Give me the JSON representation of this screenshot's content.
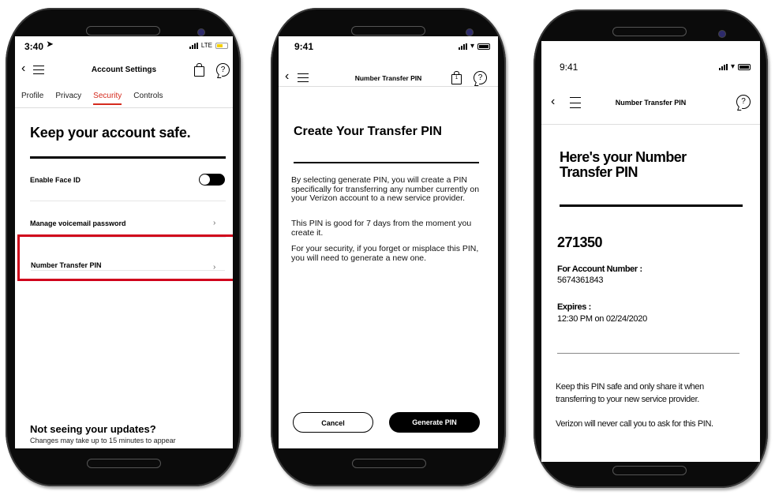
{
  "colors": {
    "accent": "#d52b1e",
    "highlight": "#d0021b",
    "toggle": "#000000"
  },
  "phone1": {
    "status": {
      "time": "3:40",
      "location_icon": "location-arrow-icon",
      "network": "LTE",
      "battery": "low-yellow"
    },
    "nav": {
      "title": "Account Settings",
      "icons": [
        "back-chevron-icon",
        "menu-icon",
        "bag-icon",
        "help-chat-icon"
      ]
    },
    "tabs": [
      {
        "label": "Profile",
        "active": false
      },
      {
        "label": "Privacy",
        "active": false
      },
      {
        "label": "Security",
        "active": true
      },
      {
        "label": "Controls",
        "active": false
      }
    ],
    "heading": "Keep your account safe.",
    "items": [
      {
        "label": "Enable Face ID",
        "control": "toggle",
        "toggle_on": true
      },
      {
        "label": "Manage voicemail password",
        "control": "chevron"
      },
      {
        "label": "Number Transfer PIN",
        "control": "chevron",
        "highlighted": true
      }
    ],
    "footer": {
      "title": "Not seeing your updates?",
      "subtitle": "Changes may take up to 15 minutes to appear"
    }
  },
  "phone2": {
    "status": {
      "time": "9:41"
    },
    "nav": {
      "title": "Number Transfer PIN",
      "bag_count": "1"
    },
    "heading": "Create Your Transfer PIN",
    "paragraphs": [
      "By selecting generate PIN, you will create a PIN specifically for transferring any number currently on your Verizon account to a new service provider.",
      "This PIN is good for 7 days from the moment you create it.",
      "For your security, if you forget or misplace this PIN, you will need to generate a new one."
    ],
    "buttons": {
      "cancel": "Cancel",
      "generate": "Generate PIN"
    }
  },
  "phone3": {
    "status": {
      "time": "9:41"
    },
    "nav": {
      "title": "Number Transfer PIN"
    },
    "heading": "Here's your Number Transfer PIN",
    "pin": "271350",
    "account_label": "For Account Number :",
    "account_number": "5674361843",
    "expires_label": "Expires :",
    "expires_value": "12:30 PM on 02/24/2020",
    "notes": [
      "Keep this PIN safe and only share it when transferring to your new service provider.",
      "Verizon will never call you to ask for this PIN."
    ]
  }
}
